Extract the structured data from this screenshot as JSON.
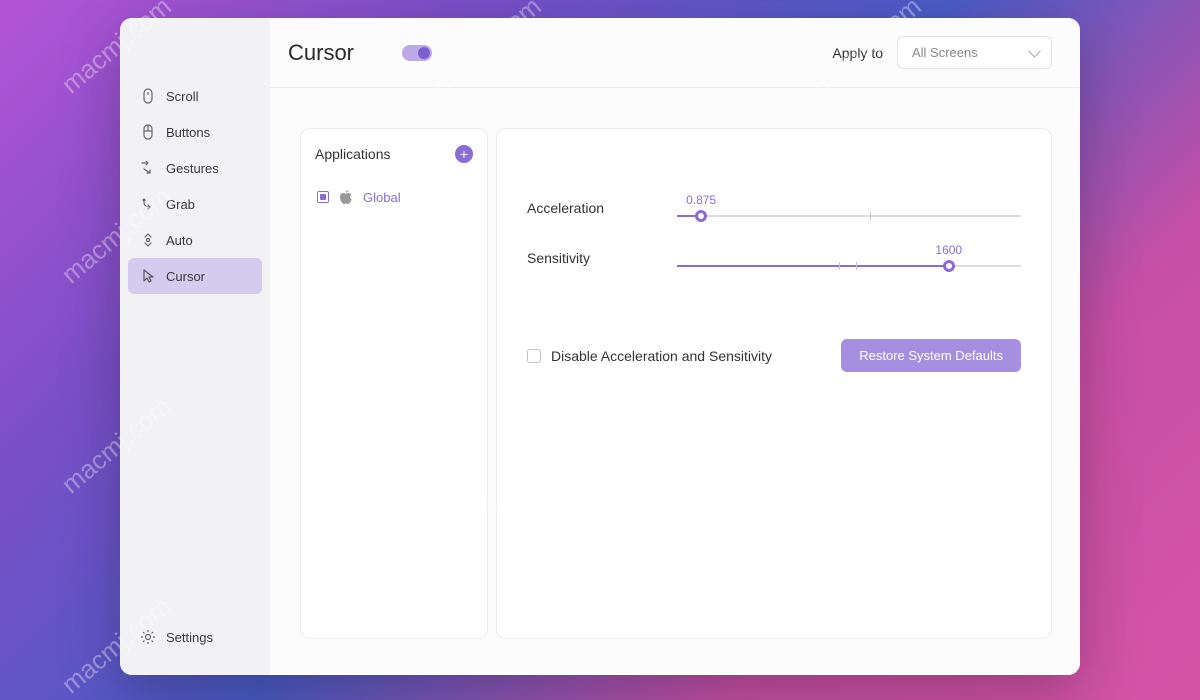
{
  "sidebar": {
    "items": [
      {
        "label": "Scroll"
      },
      {
        "label": "Buttons"
      },
      {
        "label": "Gestures"
      },
      {
        "label": "Grab"
      },
      {
        "label": "Auto"
      },
      {
        "label": "Cursor"
      }
    ],
    "footer": {
      "label": "Settings"
    }
  },
  "header": {
    "title": "Cursor",
    "apply_label": "Apply to",
    "screen_value": "All Screens"
  },
  "apps": {
    "title": "Applications",
    "items": [
      {
        "name": "Global"
      }
    ]
  },
  "sliders": {
    "acceleration": {
      "label": "Acceleration",
      "value": "0.875",
      "percent": 7
    },
    "sensitivity": {
      "label": "Sensitivity",
      "value": "1600",
      "percent": 79
    }
  },
  "bottom": {
    "disable_label": "Disable Acceleration and Sensitivity",
    "restore_label": "Restore System Defaults"
  },
  "watermark": "macmj.com"
}
